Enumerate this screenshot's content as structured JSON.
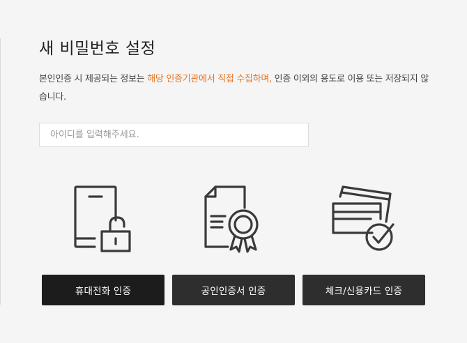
{
  "page": {
    "title": "새 비밀번호 설정",
    "notice_before": "본인인증 시 제공되는 정보는 ",
    "notice_highlight": "해당 인증기관에서 직접 수집하며,",
    "notice_after": " 인증 이외의 용도로 이용 또는 저장되지 않습니다."
  },
  "id_input": {
    "placeholder": "아이디를 입력해주세요.",
    "value": ""
  },
  "auth_options": [
    {
      "label": "휴대전화 인증",
      "icon": "mobile-phone-unlock-icon"
    },
    {
      "label": "공인인증서 인증",
      "icon": "certificate-document-icon"
    },
    {
      "label": "체크/신용카드 인증",
      "icon": "credit-card-check-icon"
    }
  ],
  "colors": {
    "accent": "#e8731f",
    "button_primary": "#1c1c1c",
    "button_secondary": "#2e2e2e",
    "background": "#f5f5f5"
  }
}
